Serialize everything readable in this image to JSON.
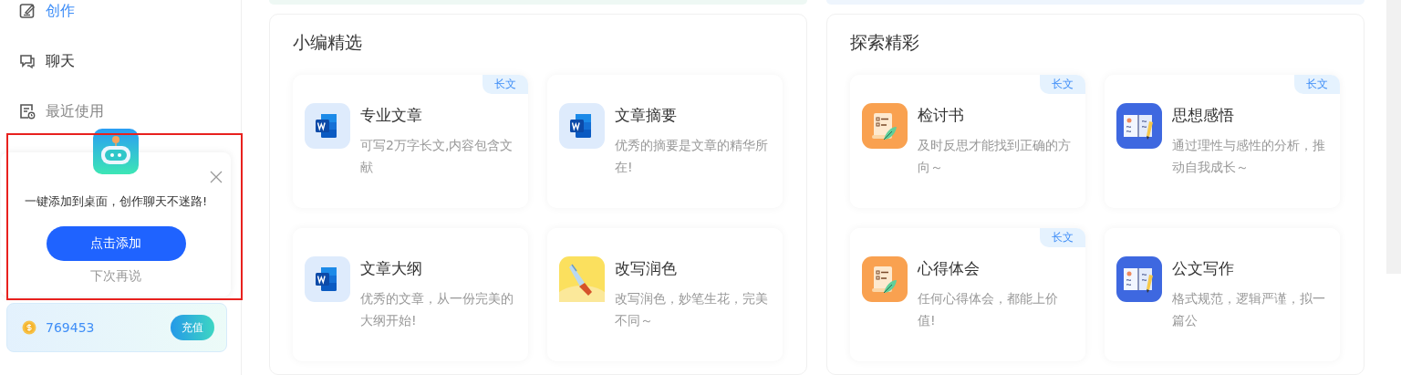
{
  "sidebar": {
    "nav": [
      {
        "label": "创作",
        "kind": "edit",
        "selected": true
      },
      {
        "label": "聊天",
        "kind": "chat",
        "selected": false
      },
      {
        "label": "最近使用",
        "kind": "history",
        "selected": false
      }
    ],
    "balance": {
      "amount": "769453",
      "button": "充值"
    }
  },
  "popup": {
    "message": "一键添加到桌面，创作聊天不迷路!",
    "primary": "点击添加",
    "secondary": "下次再说",
    "highlighted": true
  },
  "panels": [
    {
      "title": "小编精选",
      "cards": [
        {
          "title": "专业文章",
          "description": "可写2万字长文,内容包含文献",
          "kind": "word",
          "tag": "长文"
        },
        {
          "title": "文章摘要",
          "description": "优秀的摘要是文章的精华所在!",
          "kind": "word"
        },
        {
          "title": "文章大纲",
          "description": "优秀的文章，从一份完美的大纲开始!",
          "kind": "word"
        },
        {
          "title": "改写润色",
          "description": "改写润色，妙笔生花，完美不同～",
          "kind": "brush"
        }
      ]
    },
    {
      "title": "探索精彩",
      "cards": [
        {
          "title": "检讨书",
          "description": "及时反思才能找到正确的方向～",
          "kind": "scroll",
          "tag": "长文"
        },
        {
          "title": "思想感悟",
          "description": "通过理性与感性的分析，推动自我成长～",
          "kind": "book",
          "tag": "长文"
        },
        {
          "title": "心得体会",
          "description": "任何心得体会，都能上价值!",
          "kind": "scroll",
          "tag": "长文"
        },
        {
          "title": "公文写作",
          "description": "格式规范，逻辑严谨，拟一篇公",
          "kind": "book"
        }
      ]
    }
  ]
}
